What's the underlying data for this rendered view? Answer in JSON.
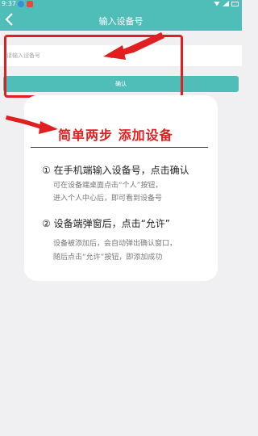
{
  "status_bar": {
    "time": "9:37"
  },
  "header": {
    "title": "输入设备号"
  },
  "form": {
    "input_placeholder": "请输入设备号",
    "confirm_label": "确认"
  },
  "guide": {
    "title": "简单两步 添加设备",
    "steps": [
      {
        "title": "① 在手机端输入设备号，点击确认",
        "lines": [
          "可在设备端桌面点击“个人”按钮，",
          "进入个人中心后，即可看到设备号"
        ]
      },
      {
        "title": "② 设备端弹窗后，点击“允许”",
        "lines": [
          "设备被添加后，会自动弹出确认窗口，",
          "随后点击“允许”按钮，即添加成功"
        ]
      }
    ]
  },
  "colors": {
    "accent": "#4fbeb8",
    "annotation_red": "#e02020",
    "background": "#f0f0f2"
  }
}
